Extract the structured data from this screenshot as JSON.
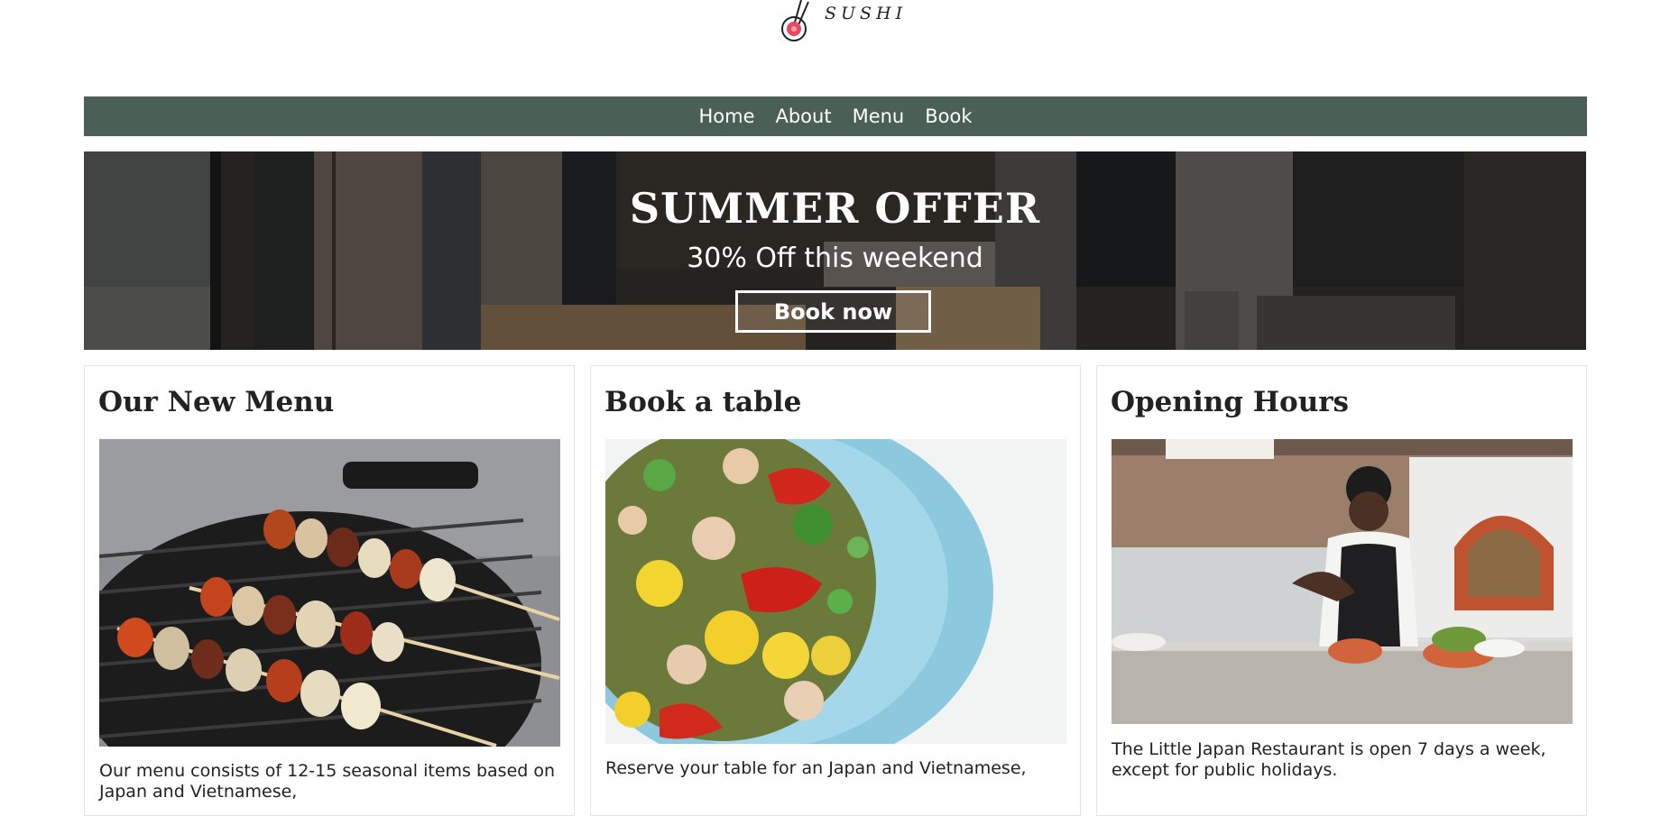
{
  "brand": {
    "logo_text": "SUSHI"
  },
  "nav": {
    "items": [
      "Home",
      "About",
      "Menu",
      "Book"
    ]
  },
  "hero": {
    "title": "SUMMER OFFER",
    "subtitle": "30% Off this weekend",
    "button_label": "Book now"
  },
  "cards": [
    {
      "title": "Our New Menu",
      "text": "Our menu consists of 12-15 seasonal items based on Japan and Vietnamese,"
    },
    {
      "title": "Book a table",
      "text": "Reserve your table for an Japan and Vietnamese,"
    },
    {
      "title": "Opening Hours",
      "text": "The Little Japan Restaurant is open 7 days a week, except for public holidays."
    }
  ],
  "colors": {
    "nav_bg": "#4a5f55",
    "logo_accent": "#e84a5f"
  },
  "icons": {
    "logo": "sushi-chopsticks-logo"
  }
}
